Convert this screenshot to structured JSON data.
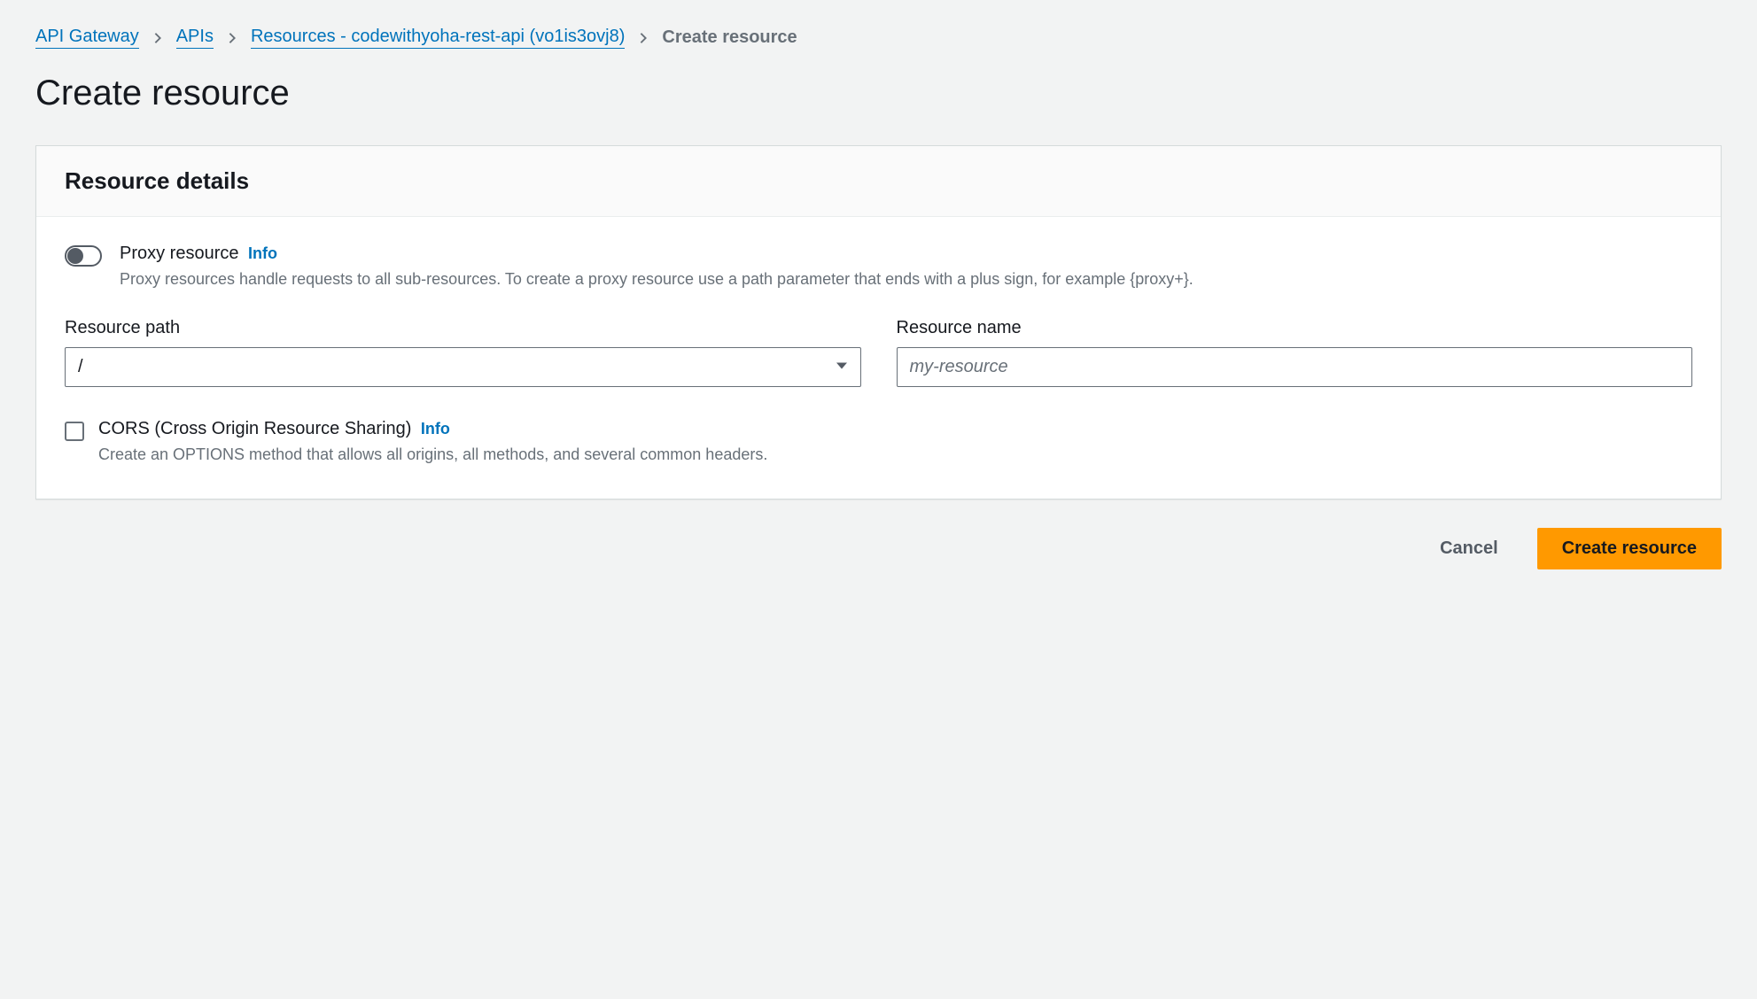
{
  "breadcrumb": {
    "items": [
      {
        "label": "API Gateway"
      },
      {
        "label": "APIs"
      },
      {
        "label": "Resources - codewithyoha-rest-api (vo1is3ovj8)"
      }
    ],
    "current": "Create resource"
  },
  "page": {
    "title": "Create resource"
  },
  "panel": {
    "header": "Resource details",
    "proxy": {
      "label": "Proxy resource",
      "info": "Info",
      "desc": "Proxy resources handle requests to all sub-resources. To create a proxy resource use a path parameter that ends with a plus sign, for example {proxy+}."
    },
    "resource_path": {
      "label": "Resource path",
      "value": "/"
    },
    "resource_name": {
      "label": "Resource name",
      "placeholder": "my-resource",
      "value": ""
    },
    "cors": {
      "label": "CORS (Cross Origin Resource Sharing)",
      "info": "Info",
      "desc": "Create an OPTIONS method that allows all origins, all methods, and several common headers."
    }
  },
  "actions": {
    "cancel": "Cancel",
    "create": "Create resource"
  }
}
